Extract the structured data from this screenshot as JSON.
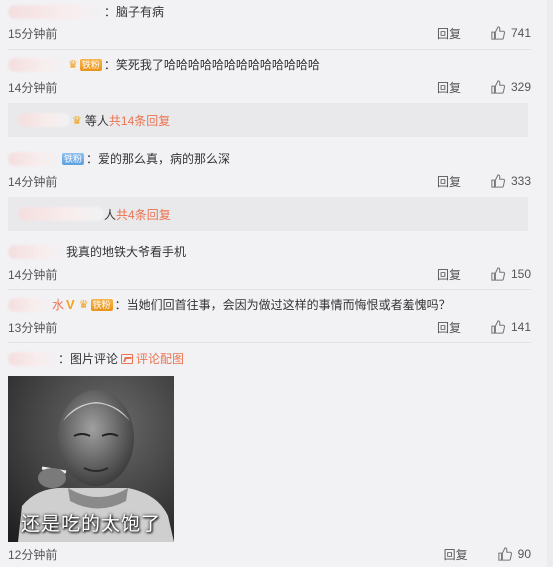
{
  "comments": [
    {
      "text": "：脑子有病",
      "time": "15分钟前",
      "reply": "回复",
      "likes": "741"
    },
    {
      "text": "：笑死我了哈哈哈哈哈哈哈哈哈哈哈哈哈",
      "time": "14分钟前",
      "reply": "回复",
      "likes": "329",
      "sub": {
        "suffix": "等人",
        "link": "共14条回复"
      }
    },
    {
      "text": "：爱的那么真，病的那么深",
      "time": "14分钟前",
      "reply": "回复",
      "likes": "333",
      "sub": {
        "suffix": "人",
        "link": "共4条回复"
      }
    },
    {
      "text": "我真的地铁大爷看手机",
      "time": "14分钟前",
      "reply": "回复",
      "likes": "150"
    },
    {
      "name_tail": "水",
      "text": "：当她们回首往事，会因为做过这样的事情而悔恨或者羞愧吗？",
      "time": "13分钟前",
      "reply": "回复",
      "likes": "141"
    },
    {
      "text": "：图片评论",
      "link": "评论配图",
      "time": "12分钟前",
      "reply": "回复",
      "likes": "90",
      "photo_caption": "还是吃的太饱了"
    }
  ],
  "badges": {
    "fan": "铁粉"
  },
  "colors": {
    "accent": "#eb7350",
    "background": "#f2f2f5"
  }
}
